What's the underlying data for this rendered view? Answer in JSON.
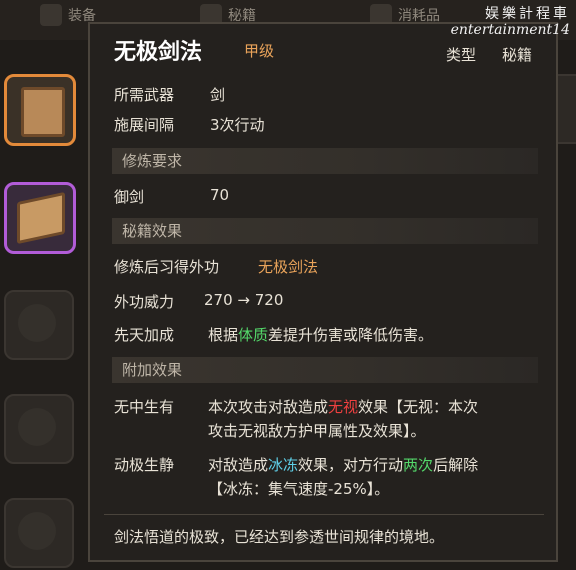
{
  "background": {
    "tabs": [
      {
        "label": "装备"
      },
      {
        "label": "秘籍"
      },
      {
        "label": "消耗品"
      }
    ]
  },
  "tooltip": {
    "title": "无极剑法",
    "grade": "甲级",
    "type_label": "类型",
    "type_value": "秘籍",
    "weapon_label": "所需武器",
    "weapon_value": "剑",
    "interval_label": "施展间隔",
    "interval_value": "3次行动",
    "req_header": "修炼要求",
    "req_skill_label": "御剑",
    "req_skill_value": "70",
    "effect_header": "秘籍效果",
    "effect_gain_label": "修炼后习得外功",
    "effect_gain_value": "无极剑法",
    "power_label": "外功威力",
    "power_value": "270 → 720",
    "innate_label": "先天加成",
    "innate_pre": "根据",
    "innate_attr": "体质",
    "innate_post": "差提升伤害或降低伤害。",
    "extra_header": "附加效果",
    "extra1_label": "无中生有",
    "extra1_pre": "本次攻击对敌造成",
    "extra1_hl": "无视",
    "extra1_post": "效果【无视：本次",
    "extra1_line2": "攻击无视敌方护甲属性及效果】。",
    "extra2_label": "动极生静",
    "extra2_pre": "对敌造成",
    "extra2_hl": "冰冻",
    "extra2_mid": "效果，对方行动",
    "extra2_hl2": "两次",
    "extra2_post": "后解除",
    "extra2_line2": "【冰冻：集气速度-25%】。",
    "footer": "剑法悟道的极致，已经达到参透世间规律的境地。"
  },
  "watermark": {
    "line1": "娱樂計程車",
    "line2": "entertainment14"
  },
  "colors": {
    "grade": "#e9a35a",
    "attr_green": "#54d86a",
    "ignore_red": "#ef4040",
    "freeze_cyan": "#5fd0e8",
    "slot_selected_orange": "#e38a3a",
    "slot_selected_purple": "#b25cd8"
  }
}
